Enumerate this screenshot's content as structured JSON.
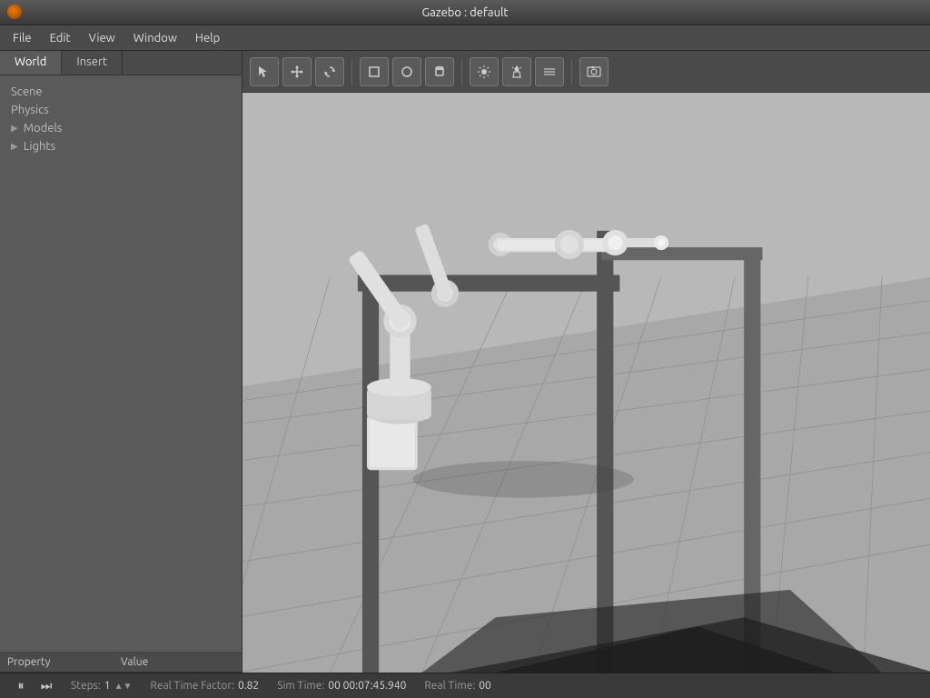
{
  "titlebar": {
    "title": "Gazebo : default"
  },
  "menubar": {
    "items": [
      {
        "label": "File",
        "id": "file"
      },
      {
        "label": "Edit",
        "id": "edit"
      },
      {
        "label": "View",
        "id": "view"
      },
      {
        "label": "Window",
        "id": "window"
      },
      {
        "label": "Help",
        "id": "help"
      }
    ]
  },
  "left_panel": {
    "tabs": [
      {
        "label": "World",
        "active": true
      },
      {
        "label": "Insert",
        "active": false
      }
    ],
    "tree": {
      "items": [
        {
          "label": "Scene",
          "has_arrow": false,
          "expanded": false
        },
        {
          "label": "Physics",
          "has_arrow": false,
          "expanded": false
        },
        {
          "label": "Models",
          "has_arrow": true,
          "expanded": false
        },
        {
          "label": "Lights",
          "has_arrow": true,
          "expanded": false
        }
      ]
    },
    "property_table": {
      "col1": "Property",
      "col2": "Value"
    }
  },
  "toolbar": {
    "buttons": [
      {
        "icon": "↖",
        "name": "select-tool",
        "tooltip": "Select"
      },
      {
        "icon": "+",
        "name": "translate-tool",
        "tooltip": "Translate"
      },
      {
        "icon": "↻",
        "name": "rotate-tool",
        "tooltip": "Rotate"
      },
      {
        "icon": "■",
        "name": "box-shape",
        "tooltip": "Box"
      },
      {
        "icon": "●",
        "name": "sphere-shape",
        "tooltip": "Sphere"
      },
      {
        "icon": "⬛",
        "name": "cylinder-shape",
        "tooltip": "Cylinder"
      },
      {
        "icon": "✦",
        "name": "point-light",
        "tooltip": "Point Light"
      },
      {
        "icon": "✧",
        "name": "spot-light",
        "tooltip": "Spot Light"
      },
      {
        "icon": "≡",
        "name": "directional-light",
        "tooltip": "Directional Light"
      },
      {
        "icon": "📷",
        "name": "screenshot",
        "tooltip": "Screenshot"
      }
    ]
  },
  "statusbar": {
    "steps_label": "Steps:",
    "steps_value": "1",
    "realtime_factor_label": "Real Time Factor:",
    "realtime_factor_value": "0.82",
    "sim_time_label": "Sim Time:",
    "sim_time_value": "00 00:07:45.940",
    "real_time_label": "Real Time:",
    "real_time_value": "00"
  }
}
